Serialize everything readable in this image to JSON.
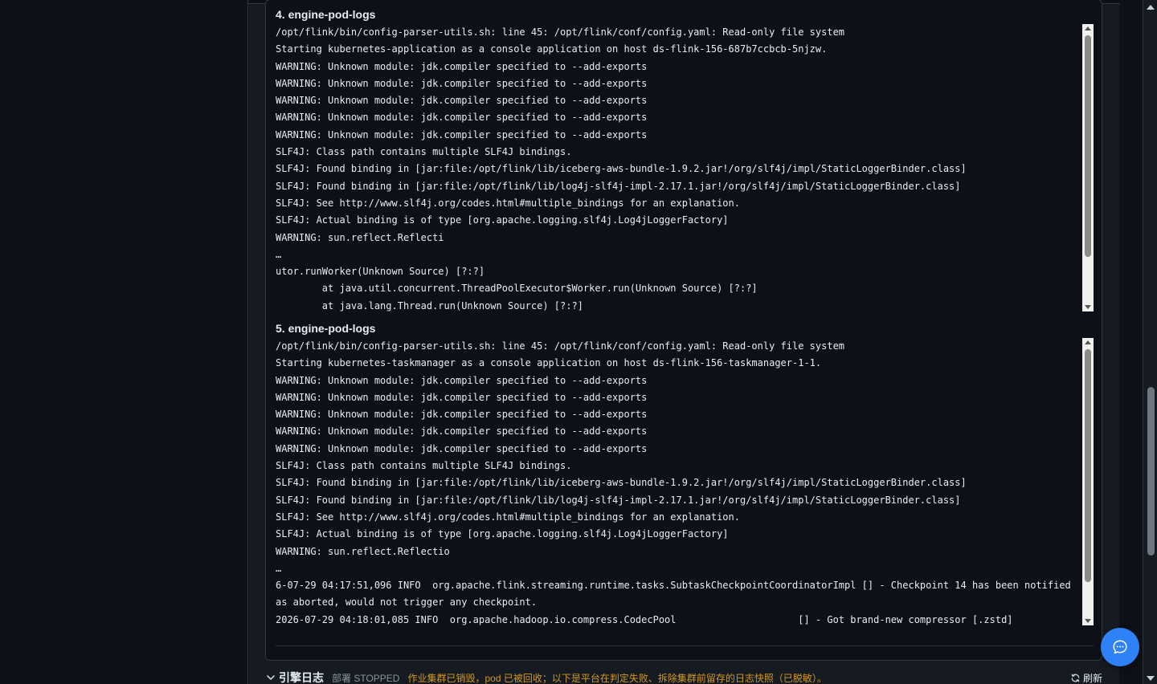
{
  "logs": {
    "section4": {
      "title": "4. engine-pod-logs",
      "lines": [
        "/opt/flink/bin/config-parser-utils.sh: line 45: /opt/flink/conf/config.yaml: Read-only file system",
        "Starting kubernetes-application as a console application on host ds-flink-156-687b7ccbcb-5njzw.",
        "WARNING: Unknown module: jdk.compiler specified to --add-exports",
        "WARNING: Unknown module: jdk.compiler specified to --add-exports",
        "WARNING: Unknown module: jdk.compiler specified to --add-exports",
        "WARNING: Unknown module: jdk.compiler specified to --add-exports",
        "WARNING: Unknown module: jdk.compiler specified to --add-exports",
        "SLF4J: Class path contains multiple SLF4J bindings.",
        "SLF4J: Found binding in [jar:file:/opt/flink/lib/iceberg-aws-bundle-1.9.2.jar!/org/slf4j/impl/StaticLoggerBinder.class]",
        "SLF4J: Found binding in [jar:file:/opt/flink/lib/log4j-slf4j-impl-2.17.1.jar!/org/slf4j/impl/StaticLoggerBinder.class]",
        "SLF4J: See http://www.slf4j.org/codes.html#multiple_bindings for an explanation.",
        "SLF4J: Actual binding is of type [org.apache.logging.slf4j.Log4jLoggerFactory]",
        "WARNING: sun.reflect.Reflecti",
        "…",
        "utor.runWorker(Unknown Source) [?:?]",
        "        at java.util.concurrent.ThreadPoolExecutor$Worker.run(Unknown Source) [?:?]",
        "        at java.lang.Thread.run(Unknown Source) [?:?]"
      ]
    },
    "section5": {
      "title": "5. engine-pod-logs",
      "lines": [
        "/opt/flink/bin/config-parser-utils.sh: line 45: /opt/flink/conf/config.yaml: Read-only file system",
        "Starting kubernetes-taskmanager as a console application on host ds-flink-156-taskmanager-1-1.",
        "WARNING: Unknown module: jdk.compiler specified to --add-exports",
        "WARNING: Unknown module: jdk.compiler specified to --add-exports",
        "WARNING: Unknown module: jdk.compiler specified to --add-exports",
        "WARNING: Unknown module: jdk.compiler specified to --add-exports",
        "WARNING: Unknown module: jdk.compiler specified to --add-exports",
        "SLF4J: Class path contains multiple SLF4J bindings.",
        "SLF4J: Found binding in [jar:file:/opt/flink/lib/iceberg-aws-bundle-1.9.2.jar!/org/slf4j/impl/StaticLoggerBinder.class]",
        "SLF4J: Found binding in [jar:file:/opt/flink/lib/log4j-slf4j-impl-2.17.1.jar!/org/slf4j/impl/StaticLoggerBinder.class]",
        "SLF4J: See http://www.slf4j.org/codes.html#multiple_bindings for an explanation.",
        "SLF4J: Actual binding is of type [org.apache.logging.slf4j.Log4jLoggerFactory]",
        "WARNING: sun.reflect.Reflectio",
        "…",
        "6-07-29 04:17:51,096 INFO  org.apache.flink.streaming.runtime.tasks.SubtaskCheckpointCoordinatorImpl [] - Checkpoint 14 has been notified as aborted, would not trigger any checkpoint.",
        "2026-07-29 04:18:01,085 INFO  org.apache.hadoop.io.compress.CodecPool                     [] - Got brand-new compressor [.zstd]"
      ]
    }
  },
  "engine_log": {
    "title": "引擎日志",
    "deploy_state": "部署 STOPPED",
    "warning": "作业集群已销毁，pod 已被回收；以下是平台在判定失败、拆除集群前留存的日志快照（已脱敏）。",
    "refresh_label": "刷新"
  },
  "icons": {
    "chevron": "chevron-down-icon",
    "refresh": "refresh-icon",
    "chat": "chat-bubble-icon"
  },
  "colors": {
    "accent": "#2f81f7",
    "warning": "#d29922",
    "background": "#0d1117"
  }
}
